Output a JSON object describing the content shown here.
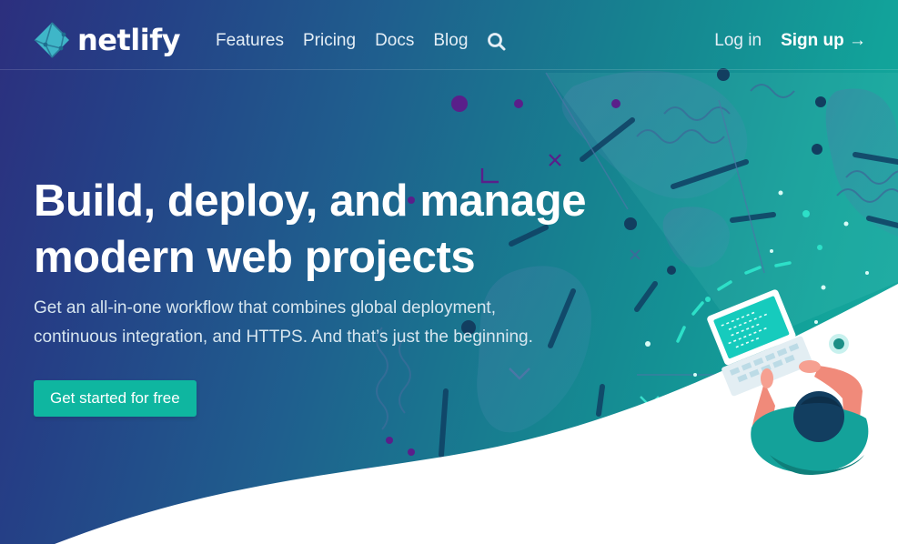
{
  "brand": {
    "name": "netlify",
    "logo_icon": "netlify-diamond-icon",
    "accent": "#0fb6a0",
    "mark_color": "#3fb6c8"
  },
  "nav": {
    "items": [
      {
        "label": "Features"
      },
      {
        "label": "Pricing"
      },
      {
        "label": "Docs"
      },
      {
        "label": "Blog"
      }
    ],
    "search_icon": "search-icon"
  },
  "account": {
    "login_label": "Log in",
    "signup_label": "Sign up →"
  },
  "hero": {
    "title_line1": "Build, deploy, and manage",
    "title_line2": "modern web projects",
    "subtitle_line1": "Get an all-in-one workflow that combines global deployment,",
    "subtitle_line2": "continuous integration, and HTTPS. And that’s just the beginning.",
    "cta_label": "Get started for free"
  },
  "illustration": {
    "icon": "developer-with-laptop-illustration"
  }
}
